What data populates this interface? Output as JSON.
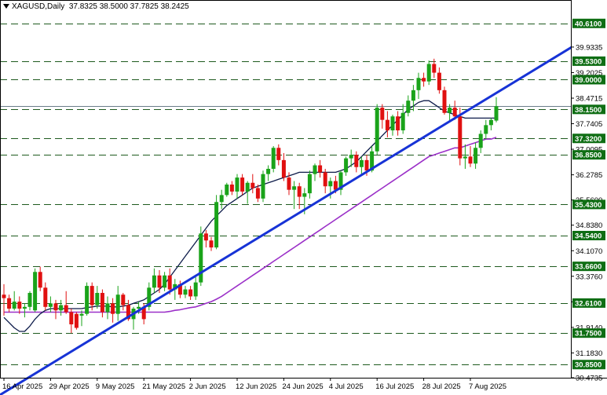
{
  "header": {
    "symbol": "XAGUSD,Daily",
    "ohlc": "37.8325 38.5000 37.7825 38.2425"
  },
  "chart_data": {
    "type": "candlestick",
    "x_labels": [
      "16 Apr 2025",
      "29 Apr 2025",
      "9 May 2025",
      "21 May 2025",
      "2 Jun 2025",
      "12 Jun 2025",
      "24 Jun 2025",
      "4 Jul 2025",
      "16 Jul 2025",
      "28 Jul 2025",
      "7 Aug 2025"
    ],
    "y_range": [
      30.4735,
      41.1
    ],
    "y_ticks": [
      "39.9335",
      "39.2025",
      "38.4715",
      "37.7405",
      "37.0095",
      "36.2785",
      "35.5600",
      "34.8380",
      "34.1070",
      "33.3760",
      "32.6450",
      "31.9140",
      "31.1830",
      "30.4735"
    ],
    "levels": [
      {
        "label": "40.6100",
        "value": 40.61
      },
      {
        "label": "39.5300",
        "value": 39.53
      },
      {
        "label": "39.0000",
        "value": 39.0
      },
      {
        "label": "38.1500",
        "value": 38.15
      },
      {
        "label": "37.3200",
        "value": 37.32
      },
      {
        "label": "36.8500",
        "value": 36.85
      },
      {
        "label": "35.4300",
        "value": 35.43
      },
      {
        "label": "34.5400",
        "value": 34.54
      },
      {
        "label": "33.6600",
        "value": 33.66
      },
      {
        "label": "32.6100",
        "value": 32.61
      },
      {
        "label": "31.7500",
        "value": 31.75
      },
      {
        "label": "30.8500",
        "value": 30.85
      }
    ],
    "current_price": "38.2425",
    "colors": {
      "up": "#1aa31a",
      "down": "#e01010",
      "level_line": "#1e5a1e",
      "level_label_bg": "#0f6e14",
      "ma_short": "#0d1b4a",
      "ma_long": "#9b30c8",
      "trendline": "#1733d6",
      "price_line": "#6a7d8a"
    },
    "candles": [
      [
        32.85,
        33.15,
        32.25,
        32.75
      ],
      [
        32.75,
        32.85,
        32.35,
        32.45
      ],
      [
        32.45,
        32.95,
        32.4,
        32.65
      ],
      [
        32.65,
        32.8,
        32.3,
        32.45
      ],
      [
        32.45,
        32.6,
        32.2,
        32.5
      ],
      [
        32.5,
        32.95,
        32.4,
        32.9
      ],
      [
        32.4,
        33.6,
        32.35,
        33.5
      ],
      [
        33.5,
        33.65,
        32.95,
        33.05
      ],
      [
        33.05,
        33.2,
        32.4,
        32.5
      ],
      [
        32.5,
        32.8,
        32.35,
        32.6
      ],
      [
        32.6,
        32.7,
        32.15,
        32.4
      ],
      [
        32.4,
        32.7,
        32.25,
        32.55
      ],
      [
        32.55,
        32.95,
        32.3,
        32.35
      ],
      [
        32.35,
        32.45,
        31.75,
        32.0
      ],
      [
        32.3,
        32.35,
        31.85,
        31.9
      ],
      [
        32.25,
        32.4,
        31.95,
        32.3
      ],
      [
        32.3,
        33.2,
        32.25,
        33.1
      ],
      [
        33.1,
        33.2,
        32.4,
        32.55
      ],
      [
        32.55,
        33.1,
        32.45,
        32.9
      ],
      [
        32.9,
        33.0,
        32.2,
        32.35
      ],
      [
        32.35,
        32.8,
        32.15,
        32.6
      ],
      [
        32.6,
        32.75,
        32.05,
        32.3
      ],
      [
        32.3,
        33.1,
        32.1,
        32.85
      ],
      [
        32.85,
        32.9,
        32.4,
        32.55
      ],
      [
        32.55,
        32.7,
        32.1,
        32.15
      ],
      [
        32.15,
        32.5,
        31.85,
        32.45
      ],
      [
        32.45,
        32.65,
        32.3,
        32.5
      ],
      [
        32.5,
        32.6,
        32.0,
        32.15
      ],
      [
        32.5,
        33.2,
        32.4,
        33.05
      ],
      [
        33.05,
        33.6,
        32.9,
        33.4
      ],
      [
        33.4,
        33.55,
        32.9,
        33.05
      ],
      [
        33.05,
        33.5,
        32.95,
        33.4
      ],
      [
        33.4,
        33.6,
        32.85,
        33.0
      ],
      [
        33.0,
        33.3,
        32.7,
        33.15
      ],
      [
        33.15,
        33.25,
        32.75,
        32.85
      ],
      [
        32.85,
        33.1,
        32.75,
        33.0
      ],
      [
        33.0,
        33.1,
        32.7,
        32.8
      ],
      [
        32.8,
        33.35,
        32.7,
        33.2
      ],
      [
        33.2,
        34.8,
        33.1,
        34.6
      ],
      [
        34.6,
        34.7,
        34.2,
        34.4
      ],
      [
        34.4,
        34.5,
        34.1,
        34.2
      ],
      [
        34.2,
        35.7,
        34.15,
        35.5
      ],
      [
        35.5,
        35.85,
        35.3,
        35.7
      ],
      [
        35.7,
        36.05,
        35.65,
        36.0
      ],
      [
        36.0,
        36.1,
        35.7,
        35.8
      ],
      [
        35.8,
        36.3,
        35.6,
        36.2
      ],
      [
        36.2,
        36.3,
        35.7,
        35.8
      ],
      [
        35.8,
        36.1,
        35.45,
        36.05
      ],
      [
        36.05,
        36.3,
        35.75,
        35.9
      ],
      [
        35.9,
        36.0,
        35.5,
        35.6
      ],
      [
        35.6,
        36.4,
        35.5,
        36.3
      ],
      [
        36.3,
        36.55,
        36.1,
        36.45
      ],
      [
        36.45,
        37.1,
        36.35,
        37.05
      ],
      [
        37.05,
        37.15,
        36.55,
        36.7
      ],
      [
        36.7,
        36.9,
        36.1,
        36.2
      ],
      [
        36.2,
        36.35,
        35.7,
        35.85
      ],
      [
        35.85,
        36.1,
        35.3,
        35.95
      ],
      [
        35.95,
        36.05,
        35.3,
        35.65
      ],
      [
        35.65,
        35.9,
        35.15,
        35.75
      ],
      [
        35.75,
        36.4,
        35.6,
        36.3
      ],
      [
        36.3,
        36.6,
        36.1,
        36.55
      ],
      [
        36.55,
        36.7,
        36.2,
        36.35
      ],
      [
        36.35,
        36.45,
        35.75,
        35.95
      ],
      [
        35.95,
        36.2,
        35.6,
        36.1
      ],
      [
        36.1,
        36.25,
        35.75,
        35.85
      ],
      [
        35.85,
        36.4,
        35.7,
        36.35
      ],
      [
        36.35,
        36.8,
        36.25,
        36.75
      ],
      [
        36.75,
        37.0,
        36.5,
        36.85
      ],
      [
        36.85,
        36.95,
        36.35,
        36.5
      ],
      [
        36.5,
        36.8,
        36.3,
        36.7
      ],
      [
        36.7,
        36.85,
        36.25,
        36.4
      ],
      [
        36.4,
        37.1,
        36.35,
        36.95
      ],
      [
        36.95,
        38.3,
        36.85,
        38.2
      ],
      [
        38.2,
        38.3,
        37.6,
        37.85
      ],
      [
        37.85,
        38.1,
        37.35,
        37.55
      ],
      [
        37.55,
        38.0,
        37.4,
        37.95
      ],
      [
        37.95,
        38.1,
        37.4,
        37.55
      ],
      [
        37.55,
        38.3,
        37.45,
        38.05
      ],
      [
        38.05,
        38.55,
        37.95,
        38.4
      ],
      [
        38.4,
        38.85,
        38.1,
        38.7
      ],
      [
        38.7,
        39.2,
        38.45,
        39.05
      ],
      [
        39.05,
        39.2,
        38.8,
        38.95
      ],
      [
        38.95,
        39.55,
        38.85,
        39.45
      ],
      [
        39.45,
        39.6,
        39.05,
        39.2
      ],
      [
        39.2,
        39.35,
        38.6,
        38.7
      ],
      [
        38.7,
        38.8,
        38.0,
        38.05
      ],
      [
        38.05,
        38.3,
        37.8,
        38.2
      ],
      [
        38.2,
        38.4,
        37.85,
        37.95
      ],
      [
        37.95,
        38.2,
        36.55,
        36.75
      ],
      [
        36.75,
        37.15,
        36.45,
        36.8
      ],
      [
        36.8,
        37.1,
        36.5,
        36.6
      ],
      [
        36.6,
        37.2,
        36.45,
        37.05
      ],
      [
        37.05,
        37.55,
        36.9,
        37.45
      ],
      [
        37.45,
        37.85,
        37.3,
        37.7
      ],
      [
        37.7,
        37.9,
        37.55,
        37.85
      ],
      [
        37.83,
        38.5,
        37.78,
        38.24
      ]
    ],
    "ma_short": [
      32.2,
      32.05,
      31.9,
      31.8,
      31.8,
      31.95,
      32.15,
      32.3,
      32.4,
      32.45,
      32.45,
      32.45,
      32.45,
      32.45,
      32.45,
      32.45,
      32.48,
      32.5,
      32.52,
      32.52,
      32.52,
      32.5,
      32.5,
      32.52,
      32.55,
      32.6,
      32.65,
      32.7,
      32.8,
      32.9,
      33.0,
      33.15,
      33.35,
      33.55,
      33.75,
      33.95,
      34.15,
      34.35,
      34.55,
      34.75,
      34.95,
      35.1,
      35.25,
      35.4,
      35.5,
      35.6,
      35.7,
      35.8,
      35.9,
      35.95,
      36.0,
      36.05,
      36.1,
      36.15,
      36.2,
      36.25,
      36.3,
      36.35,
      36.35,
      36.35,
      36.35,
      36.35,
      36.35,
      36.35,
      36.35,
      36.4,
      36.45,
      36.55,
      36.65,
      36.8,
      36.95,
      37.1,
      37.25,
      37.4,
      37.55,
      37.7,
      37.85,
      38.0,
      38.15,
      38.25,
      38.35,
      38.4,
      38.4,
      38.3,
      38.2,
      38.1,
      38.05,
      38.0,
      37.95,
      37.9,
      37.9,
      37.9,
      37.9,
      37.9,
      37.9,
      37.9
    ],
    "ma_long": [
      32.35,
      32.35,
      32.35,
      32.35,
      32.35,
      32.35,
      32.35,
      32.35,
      32.35,
      32.35,
      32.35,
      32.35,
      32.35,
      32.35,
      32.35,
      32.35,
      32.35,
      32.35,
      32.35,
      32.35,
      32.35,
      32.35,
      32.35,
      32.35,
      32.35,
      32.35,
      32.35,
      32.35,
      32.35,
      32.35,
      32.35,
      32.35,
      32.37,
      32.4,
      32.42,
      32.45,
      32.48,
      32.5,
      32.55,
      32.6,
      32.65,
      32.72,
      32.8,
      32.9,
      33.0,
      33.1,
      33.2,
      33.3,
      33.4,
      33.5,
      33.6,
      33.7,
      33.8,
      33.9,
      34.0,
      34.1,
      34.2,
      34.3,
      34.4,
      34.5,
      34.6,
      34.7,
      34.8,
      34.9,
      35.0,
      35.1,
      35.2,
      35.3,
      35.4,
      35.5,
      35.6,
      35.7,
      35.8,
      35.9,
      36.0,
      36.1,
      36.2,
      36.3,
      36.4,
      36.5,
      36.6,
      36.7,
      36.8,
      36.85,
      36.9,
      36.95,
      37.0,
      37.05,
      37.05,
      37.1,
      37.15,
      37.2,
      37.25,
      37.3,
      37.3,
      37.35
    ],
    "trendline": {
      "from": [
        0,
        30.05
      ],
      "to": [
        97,
        38.8
      ]
    }
  }
}
